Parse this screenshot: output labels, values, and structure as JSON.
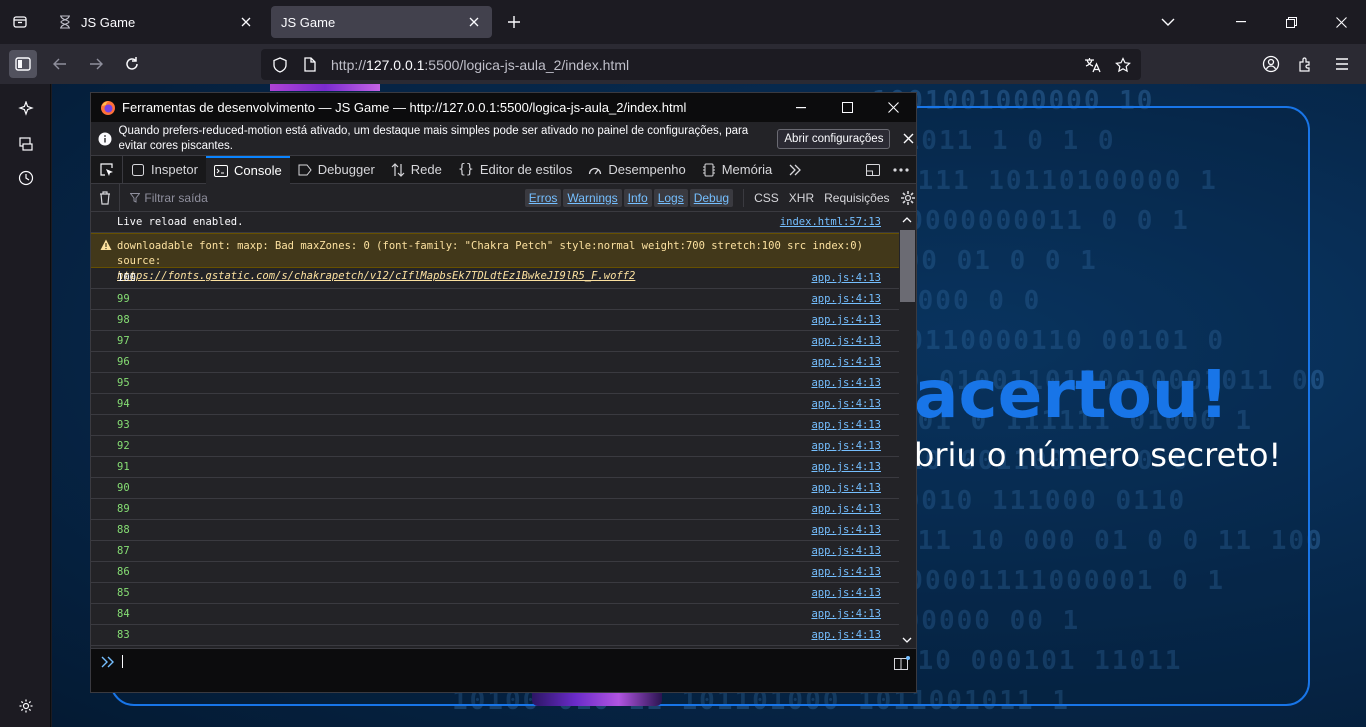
{
  "browser": {
    "tabs": [
      {
        "title": "JS Game",
        "active": false
      },
      {
        "title": "JS Game",
        "active": true
      }
    ],
    "url": {
      "prefix": "http://",
      "host": "127.0.0.1",
      "rest": ":5500/logica-js-aula_2/index.html"
    }
  },
  "page": {
    "heading": "acertou!",
    "text": "briu o número secreto!",
    "binary_lines": [
      "1001001000000 10",
      "01011 1 0    1  0",
      "0111  10110100000 1",
      "010000000011 0 0  1",
      "000 01 0      0 1",
      "1000         0   0",
      "0 0110000110 00101 0",
      "10 0100110100010001011 00",
      "101   0 111111 01000   1",
      "0110 001100110 0  0",
      "00010 111000 0110",
      "011 10 000 01 0  0 11 100",
      "0000001111000001 0  1",
      "000000 00          1",
      "110 000101 11011",
      "10100 010 11 101101000 1011001011 1"
    ],
    "colors": {
      "accent": "#1875e8"
    }
  },
  "devtools": {
    "title": "Ferramentas de desenvolvimento — JS Game — http://127.0.0.1:5500/logica-js-aula_2/index.html",
    "notice": {
      "text": "Quando prefers-reduced-motion está ativado, um destaque mais simples pode ser ativado no painel de configurações, para evitar cores piscantes.",
      "button": "Abrir configurações"
    },
    "tabs": [
      "Inspetor",
      "Console",
      "Debugger",
      "Rede",
      "Editor de estilos",
      "Desempenho",
      "Memória"
    ],
    "active_tab": "Console",
    "filter_placeholder": "Filtrar saída",
    "levels": [
      "Erros",
      "Warnings",
      "Info",
      "Logs",
      "Debug"
    ],
    "requests": [
      "CSS",
      "XHR",
      "Requisições"
    ],
    "log": {
      "reload": {
        "msg": "Live reload enabled.",
        "src": "index.html:57:13"
      },
      "warning": {
        "msg": "downloadable font: maxp: Bad maxZones: 0 (font-family: \"Chakra Petch\" style:normal weight:700 stretch:100 src index:0) source:",
        "link": "https://fonts.gstatic.com/s/chakrapetch/v12/cIflMapbsEk7TDLdtEz1BwkeJI9lR5_F.woff2"
      },
      "numbers": [
        "100",
        "99",
        "98",
        "97",
        "96",
        "95",
        "94",
        "93",
        "92",
        "91",
        "90",
        "89",
        "88",
        "87",
        "86",
        "85",
        "84",
        "83"
      ],
      "num_src": "app.js:4:13"
    }
  }
}
